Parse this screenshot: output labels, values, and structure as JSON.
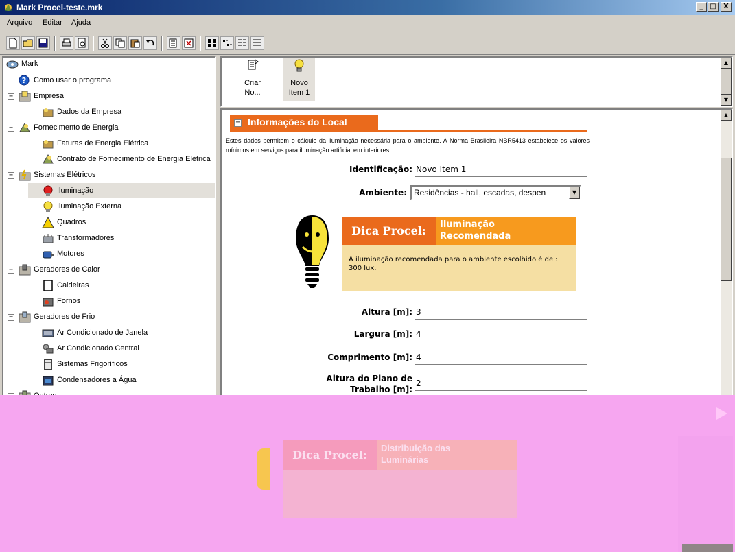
{
  "window": {
    "title": "Mark Procel-teste.mrk",
    "controls": {
      "minimize": "_",
      "maximize": "□",
      "close": "X"
    }
  },
  "menu": {
    "items": [
      "Arquivo",
      "Editar",
      "Ajuda"
    ]
  },
  "toolbar": {
    "buttons": [
      "new-icon",
      "open-icon",
      "save-icon",
      "print-icon",
      "print-preview-icon",
      "cut-icon",
      "copy-icon",
      "paste-icon",
      "undo-icon",
      "add-item-icon",
      "delete-item-icon",
      "large-icons-view-icon",
      "small-icons-view-icon",
      "list-view-icon",
      "details-view-icon"
    ]
  },
  "tree": {
    "root": "Mark",
    "help": "Como usar o programa",
    "groups": [
      {
        "label": "Empresa",
        "children": [
          "Dados da Empresa"
        ]
      },
      {
        "label": "Fornecimento de Energia",
        "children": [
          "Faturas de Energia Elétrica",
          "Contrato de Fornecimento de Energia Elétrica"
        ]
      },
      {
        "label": "Sistemas Elétricos",
        "children": [
          "Iluminação",
          "Iluminação Externa",
          "Quadros",
          "Transformadores",
          "Motores"
        ]
      },
      {
        "label": "Geradores de Calor",
        "children": [
          "Caldeiras",
          "Fornos"
        ]
      },
      {
        "label": "Geradores de Frio",
        "children": [
          "Ar Condicionado de Janela",
          "Ar Condicionado Central",
          "Sistemas Frigoríficos",
          "Condensadores a Água"
        ]
      },
      {
        "label": "Outros",
        "children": []
      }
    ],
    "selected": "Iluminação"
  },
  "items_pane": {
    "items": [
      {
        "label_line1": "Criar",
        "label_line2": "No...",
        "icon": "new-item-icon"
      },
      {
        "label_line1": "Novo",
        "label_line2": "Item 1",
        "icon": "lightbulb-icon"
      }
    ]
  },
  "section": {
    "title": "Informações do Local",
    "description": "Estes dados permitem o cálculo da iluminação necessária para o ambiente. A Norma Brasileira NBR5413 estabelece os valores mínimos em serviços para iluminação artificial em interiores."
  },
  "form": {
    "identificacao": {
      "label": "Identificação:",
      "value": "Novo Item 1"
    },
    "ambiente": {
      "label": "Ambiente:",
      "value": "Residências - hall, escadas, despen"
    },
    "altura": {
      "label": "Altura [m]:",
      "value": "3"
    },
    "largura": {
      "label": "Largura [m]:",
      "value": "4"
    },
    "comprimento": {
      "label": "Comprimento [m]:",
      "value": "4"
    },
    "altura_plano": {
      "label_line1": "Altura do Plano de",
      "label_line2": "Trabalho [m]:",
      "value": "2"
    }
  },
  "tip": {
    "heading": "Dica Procel:",
    "subject_line1": "Iluminação",
    "subject_line2": "Recomendada",
    "body": "A iluminação recomendada para o ambiente escolhido é de : 300 lux."
  },
  "overlay_tip": {
    "heading": "Dica Procel:",
    "subject_line1": "Distribuição das",
    "subject_line2": "Luminárias"
  },
  "colors": {
    "accent_orange": "#ea6a1c",
    "accent_orange_light": "#f79a1e",
    "tip_body": "#f5dfa3",
    "selection": "#e3e0da",
    "overlay_magenta": "#f6a6f0"
  }
}
